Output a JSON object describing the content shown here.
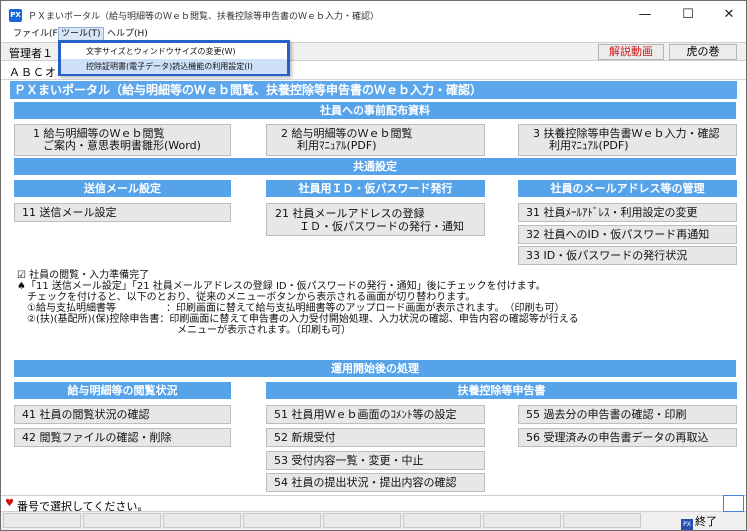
{
  "window": {
    "app_icon": "PX",
    "title": "ＰＸまいポータル（給与明細等のＷｅｂ閲覧、扶養控除等申告書のＷｅｂ入力・確認）",
    "minimize": "—",
    "maximize": "☐",
    "close": "✕"
  },
  "menubar": {
    "file": "ファイル(F)",
    "tools": "ツール(T)",
    "help": "ヘルプ(H)"
  },
  "tools_menu": {
    "items": [
      "文字サイズとウィンドウサイズの変更(W)",
      "控除証明書(電子データ)読込機能の利用設定(I)"
    ]
  },
  "header": {
    "admin_label": "管理者１",
    "video_button": "解説動画",
    "guide_button": "虎の巻",
    "company": "ＡＢＣオ"
  },
  "banner": "ＰＸまいポータル（給与明細等のＷｅｂ閲覧、扶養控除等申告書のＷｅｂ入力・確認）",
  "sections": {
    "advance": "社員への事前配布資料",
    "common": "共通設定",
    "operation": "運用開始後の処理"
  },
  "advance_buttons": [
    {
      "line1": "1 給与明細等のＷｅｂ閲覧",
      "line2": "ご案内・意思表明書雛形(Word)"
    },
    {
      "line1": "2 給与明細等のＷｅｂ閲覧",
      "line2": "利用ﾏﾆｭｱﾙ(PDF)"
    },
    {
      "line1": "3 扶養控除等申告書Ｗｅｂ入力・確認",
      "line2": "利用ﾏﾆｭｱﾙ(PDF)"
    }
  ],
  "common": {
    "col1_header": "送信メール設定",
    "col2_header": "社員用ＩＤ・仮パスワード発行",
    "col3_header": "社員のメールアドレス等の管理",
    "btn11": "11 送信メール設定",
    "btn21_line1": "21 社員メールアドレスの登録",
    "btn21_line2": "ＩＤ・仮パスワードの発行・通知",
    "btn31": "31 社員ﾒｰﾙｱﾄﾞﾚｽ・利用設定の変更",
    "btn32": "32 社員へのID・仮パスワード再通知",
    "btn33": "33 ID・仮パスワードの発行状況"
  },
  "notice": {
    "checkbox_label": "☑ 社員の閲覧・入力準備完了",
    "lines": [
      "♠「11 送信メール設定」「21 社員メールアドレスの登録 ID・仮パスワードの発行・通知」後にチェックを付けます。",
      "　チェックを付けると、以下のとおり、従来のメニューボタンから表示される画面が切り替わります。",
      "　①給与支払明細書等　　　　　：印刷画面に替えて給与支払明細書等のアップロード画面が表示されます。　（印刷も可）",
      "　②(扶)(基配所)(保)控除申告書：印刷画面に替えて申告書の入力受付開始処理、入力状況の確認、申告内容の確認等が行える",
      "　　　　　　　　　　　　　　　　メニューが表示されます。（印刷も可）"
    ]
  },
  "operation": {
    "col1_header": "給与明細等の閲覧状況",
    "col2_header": "扶養控除等申告書",
    "btn41": "41 社員の閲覧状況の確認",
    "btn42": "42 閲覧ファイルの確認・削除",
    "btn51": "51 社員用Ｗｅｂ画面のｺﾒﾝﾄ等の設定",
    "btn52": "52 新規受付",
    "btn53": "53 受付内容一覧・変更・中止",
    "btn54": "54 社員の提出状況・提出内容の確認",
    "btn55": "55 過去分の申告書の確認・印刷",
    "btn56": "56 受理済みの申告書データの再取込"
  },
  "status": {
    "marker": "♥",
    "text": "番号で選択してください。"
  },
  "bottom": {
    "exit_icon": "PX",
    "exit_label": "終了"
  }
}
